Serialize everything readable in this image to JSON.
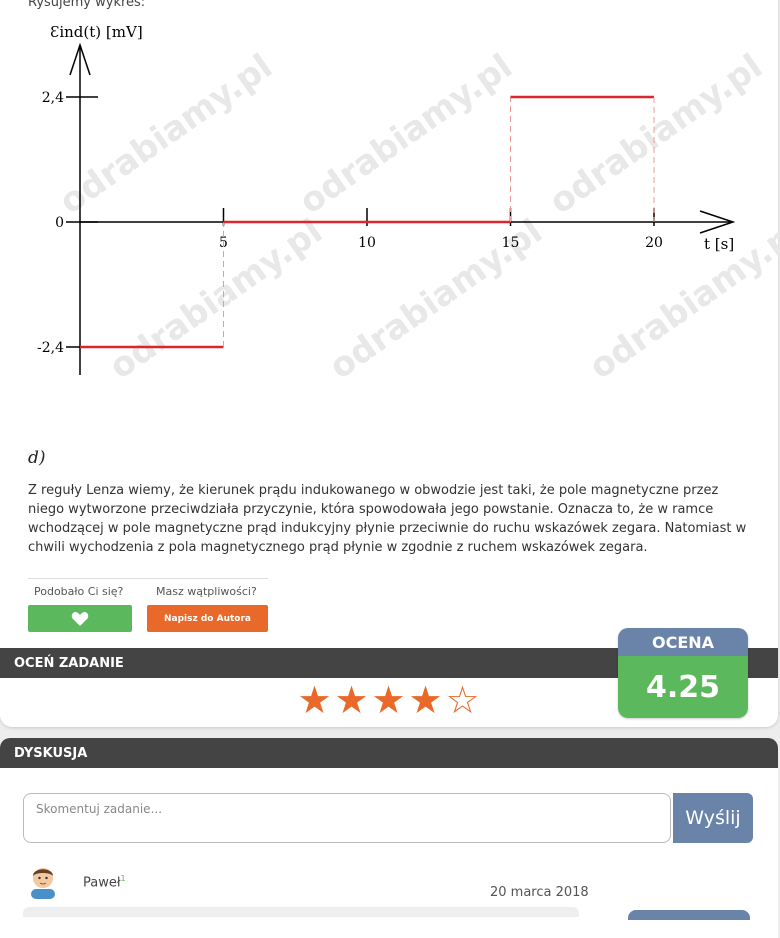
{
  "intro_text": "Rysujemy wykres:",
  "watermark": "odrabiamy.pl",
  "chart_data": {
    "type": "line",
    "title": "",
    "ylabel": "Ɛind(t) [mV]",
    "xlabel": "t [s]",
    "x_ticks": [
      "5",
      "10",
      "15",
      "20"
    ],
    "y_ticks": [
      "2,4",
      "0",
      "-2,4"
    ],
    "xlim": [
      0,
      20
    ],
    "ylim": [
      -2.4,
      2.4
    ],
    "series": [
      {
        "color": "#d9272e",
        "points": [
          [
            0,
            -2.4
          ],
          [
            5,
            -2.4
          ],
          [
            5,
            0
          ],
          [
            15,
            0
          ],
          [
            15,
            2.4
          ],
          [
            20,
            2.4
          ]
        ]
      }
    ]
  },
  "part_label": "d)",
  "paragraph": "Z reguły Lenza wiemy, że kierunek prądu indukowanego w obwodzie jest taki, że pole magnetyczne przez niego wytworzone przeciwdziała przyczynie, która spowodowała jego powstanie. Oznacza to, że w ramce wchodzącej w pole magnetyczne prąd indukcyjny płynie przeciwnie do ruchu wskazówek zegara. Natomiast w chwili wychodzenia z pola magnetycznego prąd płynie w zgodnie z ruchem wskazówek zegara.",
  "feedback": {
    "liked_label": "Podobało Ci się?",
    "doubts_label": "Masz wątpliwości?",
    "like_icon": "heart-icon",
    "author_button": "Napisz do Autora"
  },
  "rating": {
    "section_title": "OCEŃ ZADANIE",
    "stars_filled": 4,
    "stars_total": 5,
    "score_label": "OCENA",
    "score_value": "4.25"
  },
  "discussion": {
    "section_title": "DYSKUSJA",
    "placeholder": "Skomentuj zadanie...",
    "send_button": "Wyślij",
    "comments": [
      {
        "user": "Paweł",
        "badge": "1",
        "date": "20 marca 2018"
      }
    ]
  },
  "colors": {
    "accent_orange": "#e8692a",
    "accent_green": "#5cb85c",
    "accent_blue": "#6a83a8",
    "line_red": "#d9272e"
  }
}
